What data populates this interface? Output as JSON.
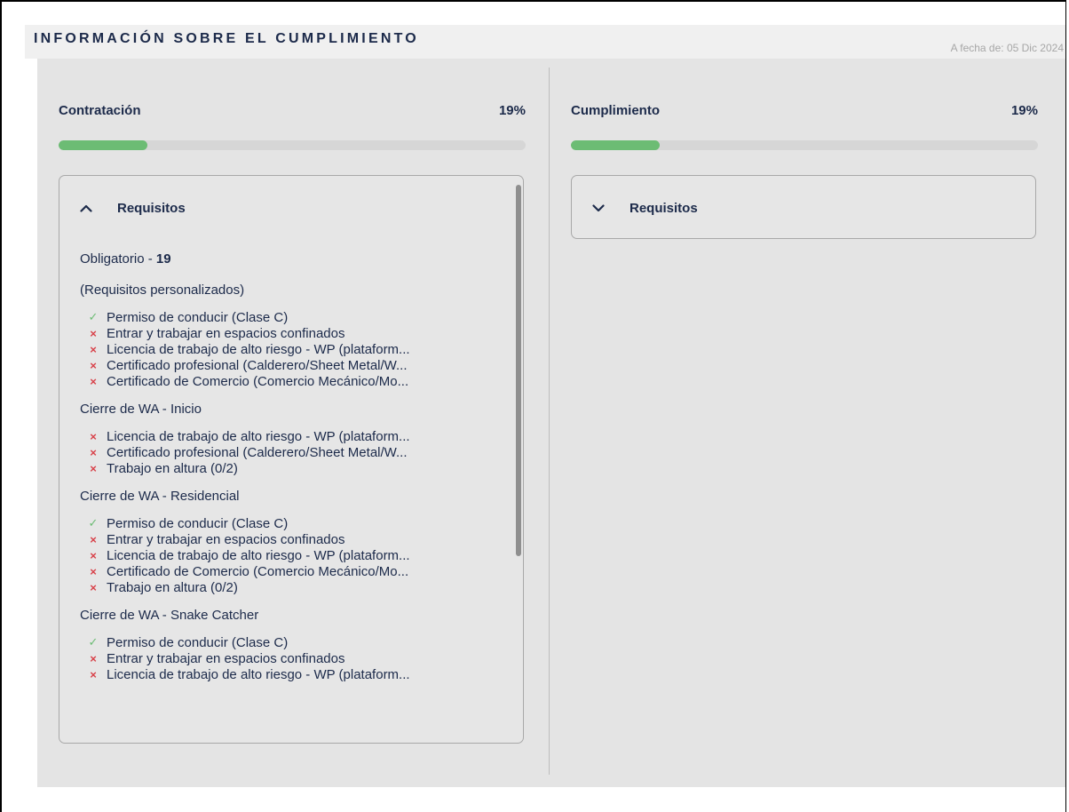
{
  "header": {
    "title": "INFORMACIÓN SOBRE EL CUMPLIMIENTO",
    "as_of": "A fecha de: 05 Dic 2024"
  },
  "colors": {
    "accent_green": "#6cbc74",
    "fail_red": "#d8424a",
    "text_navy": "#1c2a4a"
  },
  "left": {
    "title": "Contratación",
    "percent_label": "19%",
    "progress_fraction": 0.19,
    "requirements": {
      "label": "Requisitos",
      "expanded": true,
      "mandatory_label": "Obligatorio - ",
      "mandatory_count": "19",
      "groups": [
        {
          "title": "(Requisitos personalizados)",
          "items": [
            {
              "status": "ok",
              "text": "Permiso de conducir (Clase C)"
            },
            {
              "status": "fail",
              "text": "Entrar y trabajar en espacios confinados"
            },
            {
              "status": "fail",
              "text": "Licencia de trabajo de alto riesgo - WP (plataform..."
            },
            {
              "status": "fail",
              "text": "Certificado profesional (Calderero/Sheet Metal/W..."
            },
            {
              "status": "fail",
              "text": "Certificado de Comercio (Comercio Mecánico/Mo..."
            }
          ]
        },
        {
          "title": "Cierre de WA - Inicio",
          "items": [
            {
              "status": "fail",
              "text": "Licencia de trabajo de alto riesgo - WP (plataform..."
            },
            {
              "status": "fail",
              "text": "Certificado profesional (Calderero/Sheet Metal/W..."
            },
            {
              "status": "fail",
              "text": "Trabajo en altura (0/2)"
            }
          ]
        },
        {
          "title": "Cierre de WA - Residencial",
          "items": [
            {
              "status": "ok",
              "text": "Permiso de conducir (Clase C)"
            },
            {
              "status": "fail",
              "text": "Entrar y trabajar en espacios confinados"
            },
            {
              "status": "fail",
              "text": "Licencia de trabajo de alto riesgo - WP (plataform..."
            },
            {
              "status": "fail",
              "text": "Certificado de Comercio (Comercio Mecánico/Mo..."
            },
            {
              "status": "fail",
              "text": "Trabajo en altura (0/2)"
            }
          ]
        },
        {
          "title": "Cierre de WA - Snake Catcher",
          "items": [
            {
              "status": "ok",
              "text": "Permiso de conducir (Clase C)"
            },
            {
              "status": "fail",
              "text": "Entrar y trabajar en espacios confinados"
            },
            {
              "status": "fail",
              "text": "Licencia de trabajo de alto riesgo - WP (plataform..."
            }
          ]
        }
      ]
    }
  },
  "right": {
    "title": "Cumplimiento",
    "percent_label": "19%",
    "progress_fraction": 0.19,
    "requirements": {
      "label": "Requisitos",
      "expanded": false
    }
  }
}
